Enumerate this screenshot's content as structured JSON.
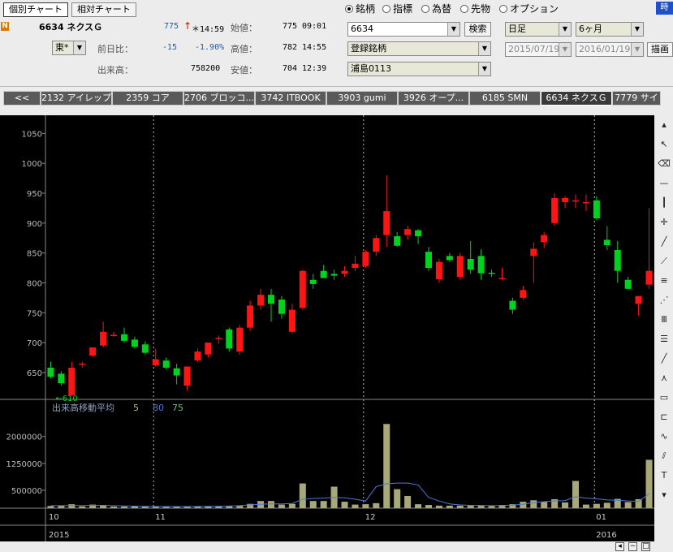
{
  "header": {
    "tab_individual": "個別チャート",
    "tab_relative": "相対チャート",
    "badge": "N",
    "code_name": "6634 ネクスＧ",
    "price": "775",
    "arrow": "↑",
    "time": "＊14:59",
    "exchange": "東*",
    "change_label": "前日比：",
    "change_value": "-15",
    "change_pct": "-1.90%",
    "volume_label": "出来高：",
    "volume_value": "758200",
    "open_label": "始値：",
    "open_value": "775",
    "open_time": "09:01",
    "high_label": "高値：",
    "high_value": "782",
    "high_time": "14:55",
    "low_label": "安値：",
    "low_value": "704",
    "low_time": "12:39"
  },
  "search": {
    "radios": [
      {
        "label": "銘柄",
        "selected": true
      },
      {
        "label": "指標",
        "selected": false
      },
      {
        "label": "為替",
        "selected": false
      },
      {
        "label": "先物",
        "selected": false
      },
      {
        "label": "オプション",
        "selected": false
      }
    ],
    "code_value": "6634",
    "search_button": "検索",
    "registered": "登録銘柄",
    "list_name": "浦島0113",
    "period": "日足",
    "range": "6ヶ月",
    "date_from": "2015/07/19",
    "date_to": "2016/01/19",
    "draw_button": "描画",
    "corner_label": "時"
  },
  "tabs": [
    "<<",
    "2132 アイレップ",
    "2359 コア",
    "2706 ブロッコ...",
    "3742 ITBOOK",
    "3903 gumi",
    "3926 オープ...",
    "6185 SMN",
    "6634 ネクスＧ",
    "7779 サイ"
  ],
  "active_tab": 8,
  "colors": {
    "up": "#ff1414",
    "down": "#00d21e",
    "volume": "#a8a878",
    "grid": "#bbbbbb",
    "ma": "#4a7ad8"
  },
  "chart_data": {
    "type": "candlestick",
    "price_axis": {
      "ticks": [
        650,
        700,
        750,
        800,
        850,
        900,
        950,
        1000,
        1050
      ],
      "ylim": [
        605,
        1075
      ]
    },
    "min_label": "←610",
    "volume_title": "出来高移動平均",
    "volume_ma_periods": [
      "5",
      "80",
      "75"
    ],
    "volume_axis": {
      "ticks": [
        "2000000",
        "1250000",
        "500000"
      ],
      "tick_values": [
        2000000,
        1250000,
        500000
      ],
      "ylim": [
        0,
        2900000
      ]
    },
    "month_labels": [
      {
        "label": "10",
        "index": 0
      },
      {
        "label": "11",
        "index": 10
      },
      {
        "label": "12",
        "index": 30
      },
      {
        "label": "01",
        "index": 52
      }
    ],
    "year_labels": [
      {
        "label": "2015",
        "index": 0
      },
      {
        "label": "2016",
        "index": 52
      }
    ],
    "candles": [
      {
        "o": 658,
        "h": 668,
        "l": 640,
        "c": 643
      },
      {
        "o": 648,
        "h": 652,
        "l": 628,
        "c": 632
      },
      {
        "o": 612,
        "h": 668,
        "l": 610,
        "c": 658
      },
      {
        "o": 665,
        "h": 668,
        "l": 658,
        "c": 665
      },
      {
        "o": 678,
        "h": 686,
        "l": 676,
        "c": 692
      },
      {
        "o": 695,
        "h": 735,
        "l": 692,
        "c": 718
      },
      {
        "o": 713,
        "h": 718,
        "l": 710,
        "c": 713
      },
      {
        "o": 714,
        "h": 725,
        "l": 700,
        "c": 703
      },
      {
        "o": 705,
        "h": 710,
        "l": 690,
        "c": 693
      },
      {
        "o": 697,
        "h": 702,
        "l": 680,
        "c": 683
      },
      {
        "o": 662,
        "h": 690,
        "l": 660,
        "c": 672
      },
      {
        "o": 670,
        "h": 675,
        "l": 655,
        "c": 658
      },
      {
        "o": 657,
        "h": 665,
        "l": 630,
        "c": 645
      },
      {
        "o": 628,
        "h": 658,
        "l": 620,
        "c": 660
      },
      {
        "o": 670,
        "h": 690,
        "l": 668,
        "c": 685
      },
      {
        "o": 680,
        "h": 700,
        "l": 675,
        "c": 700
      },
      {
        "o": 708,
        "h": 712,
        "l": 698,
        "c": 708
      },
      {
        "o": 722,
        "h": 725,
        "l": 685,
        "c": 690
      },
      {
        "o": 685,
        "h": 730,
        "l": 680,
        "c": 725
      },
      {
        "o": 725,
        "h": 770,
        "l": 720,
        "c": 762
      },
      {
        "o": 762,
        "h": 790,
        "l": 755,
        "c": 780
      },
      {
        "o": 780,
        "h": 790,
        "l": 735,
        "c": 765
      },
      {
        "o": 772,
        "h": 778,
        "l": 740,
        "c": 748
      },
      {
        "o": 718,
        "h": 765,
        "l": 715,
        "c": 755
      },
      {
        "o": 758,
        "h": 822,
        "l": 755,
        "c": 820
      },
      {
        "o": 805,
        "h": 815,
        "l": 790,
        "c": 798
      },
      {
        "o": 820,
        "h": 830,
        "l": 810,
        "c": 808
      },
      {
        "o": 815,
        "h": 822,
        "l": 805,
        "c": 812
      },
      {
        "o": 815,
        "h": 828,
        "l": 810,
        "c": 820
      },
      {
        "o": 825,
        "h": 845,
        "l": 820,
        "c": 832
      },
      {
        "o": 828,
        "h": 855,
        "l": 825,
        "c": 852
      },
      {
        "o": 852,
        "h": 880,
        "l": 845,
        "c": 875
      },
      {
        "o": 880,
        "h": 980,
        "l": 860,
        "c": 920
      },
      {
        "o": 878,
        "h": 885,
        "l": 860,
        "c": 862
      },
      {
        "o": 880,
        "h": 895,
        "l": 872,
        "c": 890
      },
      {
        "o": 888,
        "h": 890,
        "l": 865,
        "c": 878
      },
      {
        "o": 852,
        "h": 860,
        "l": 820,
        "c": 825
      },
      {
        "o": 806,
        "h": 840,
        "l": 800,
        "c": 835
      },
      {
        "o": 845,
        "h": 850,
        "l": 835,
        "c": 838
      },
      {
        "o": 810,
        "h": 850,
        "l": 805,
        "c": 845
      },
      {
        "o": 840,
        "h": 870,
        "l": 815,
        "c": 822
      },
      {
        "o": 845,
        "h": 856,
        "l": 805,
        "c": 816
      },
      {
        "o": 817,
        "h": 822,
        "l": 810,
        "c": 815
      },
      {
        "o": 808,
        "h": 825,
        "l": 805,
        "c": 808
      },
      {
        "o": 770,
        "h": 775,
        "l": 748,
        "c": 755
      },
      {
        "o": 775,
        "h": 795,
        "l": 772,
        "c": 788
      },
      {
        "o": 845,
        "h": 868,
        "l": 800,
        "c": 857
      },
      {
        "o": 868,
        "h": 885,
        "l": 858,
        "c": 880
      },
      {
        "o": 900,
        "h": 950,
        "l": 895,
        "c": 942
      },
      {
        "o": 935,
        "h": 945,
        "l": 925,
        "c": 942
      },
      {
        "o": 938,
        "h": 948,
        "l": 925,
        "c": 938
      },
      {
        "o": 935,
        "h": 948,
        "l": 920,
        "c": 935
      },
      {
        "o": 938,
        "h": 945,
        "l": 905,
        "c": 908
      },
      {
        "o": 872,
        "h": 895,
        "l": 855,
        "c": 863
      },
      {
        "o": 855,
        "h": 870,
        "l": 800,
        "c": 820
      },
      {
        "o": 805,
        "h": 810,
        "l": 790,
        "c": 790
      },
      {
        "o": 765,
        "h": 775,
        "l": 745,
        "c": 778
      },
      {
        "o": 797,
        "h": 925,
        "l": 790,
        "c": 820
      }
    ],
    "volumes": [
      60000,
      70000,
      110000,
      50000,
      100000,
      90000,
      45000,
      45000,
      50000,
      45000,
      55000,
      50000,
      40000,
      45000,
      45000,
      55000,
      50000,
      60000,
      75000,
      120000,
      200000,
      200000,
      100000,
      120000,
      690000,
      200000,
      200000,
      600000,
      180000,
      100000,
      110000,
      140000,
      2350000,
      530000,
      340000,
      110000,
      90000,
      70000,
      70000,
      70000,
      75000,
      70000,
      60000,
      90000,
      110000,
      180000,
      220000,
      180000,
      250000,
      160000,
      760000,
      100000,
      120000,
      150000,
      260000,
      170000,
      250000,
      1350000
    ],
    "volume_ma": [
      70000,
      70000,
      75000,
      75000,
      78000,
      80000,
      70000,
      62000,
      56000,
      50000,
      48000,
      46000,
      45000,
      46000,
      48000,
      52000,
      55000,
      60000,
      70000,
      90000,
      110000,
      120000,
      120000,
      130000,
      250000,
      270000,
      280000,
      300000,
      290000,
      250000,
      200000,
      600000,
      680000,
      700000,
      700000,
      650000,
      300000,
      200000,
      120000,
      90000,
      80000,
      76000,
      70000,
      75000,
      85000,
      110000,
      150000,
      180000,
      200000,
      210000,
      320000,
      280000,
      260000,
      230000,
      220000,
      200000,
      190000,
      400000
    ]
  }
}
